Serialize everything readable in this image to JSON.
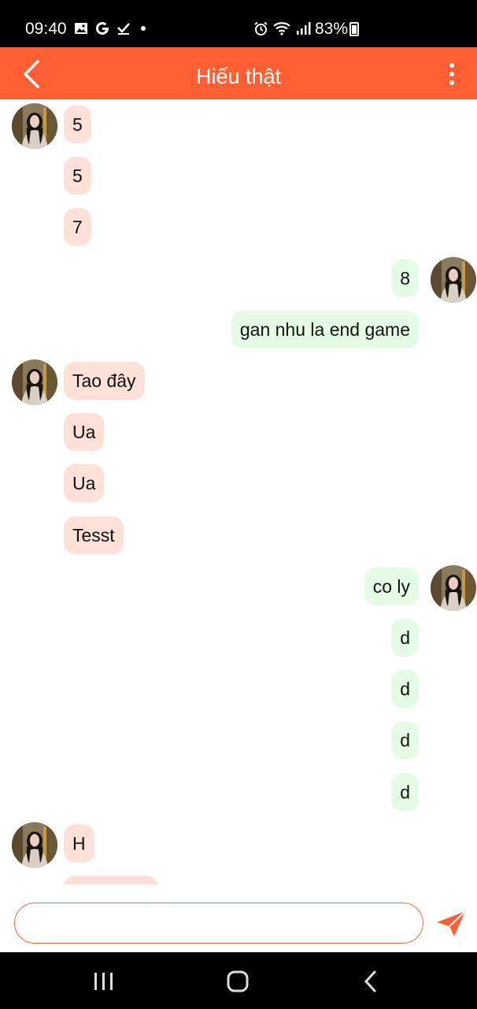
{
  "status": {
    "time": "09:40",
    "battery": "83%",
    "icons": [
      "gallery-icon",
      "google-icon",
      "check-icon",
      "dot-icon",
      "alarm-icon",
      "wifi-icon",
      "signal-icon",
      "battery-icon"
    ]
  },
  "header": {
    "title": "Hiếu thật",
    "back_icon": "chevron-left-icon",
    "menu_icon": "more-vertical-icon"
  },
  "messages": [
    {
      "side": "in",
      "text": "5",
      "avatar": true
    },
    {
      "side": "in",
      "text": "5"
    },
    {
      "side": "in",
      "text": "7"
    },
    {
      "side": "out",
      "text": "8",
      "avatar": true
    },
    {
      "side": "out",
      "text": "gan nhu la end game"
    },
    {
      "side": "in",
      "text": "Tao đây",
      "avatar": true
    },
    {
      "side": "in",
      "text": "Ua"
    },
    {
      "side": "in",
      "text": "Ua"
    },
    {
      "side": "in",
      "text": "Tesst"
    },
    {
      "side": "out",
      "text": "co ly",
      "avatar": true
    },
    {
      "side": "out",
      "text": "d"
    },
    {
      "side": "out",
      "text": "d"
    },
    {
      "side": "out",
      "text": "d"
    },
    {
      "side": "out",
      "text": "d"
    },
    {
      "side": "in",
      "text": "H",
      "avatar": true
    },
    {
      "side": "in",
      "text": ""
    }
  ],
  "input": {
    "value": "",
    "placeholder": ""
  },
  "send_icon": "send-icon",
  "colors": {
    "header": "#ff5f33",
    "incoming_bubble": "#fde0d8",
    "outgoing_bubble": "#e5fbe5",
    "input_border": "#e86b42"
  },
  "navbar": {
    "icons": [
      "recent-apps-icon",
      "home-icon",
      "back-icon"
    ]
  }
}
